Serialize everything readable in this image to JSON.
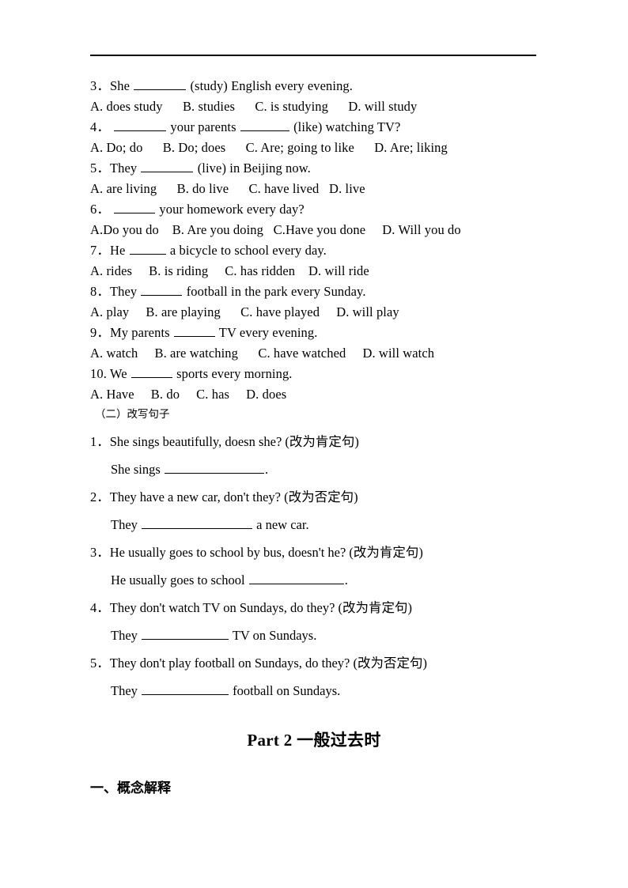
{
  "document": {
    "rule_present": true,
    "mc_questions": [
      {
        "prompt_pre": "3．She ",
        "blank1_width": 66,
        "prompt_post": " (study) English every evening.",
        "options": "A. does study      B. studies      C. is studying      D. will study"
      },
      {
        "prompt_pre": "4． ",
        "blank1_width": 66,
        "prompt_mid": " your parents ",
        "blank2_width": 62,
        "prompt_post": " (like) watching TV?",
        "options": "A. Do; do      B. Do; does      C. Are; going to like      D. Are; liking"
      },
      {
        "prompt_pre": "5．They ",
        "blank1_width": 66,
        "prompt_post": " (live) in Beijing now.",
        "options": "A. are living      B. do live      C. have lived   D. live"
      },
      {
        "prompt_pre": "6． ",
        "blank1_width": 52,
        "prompt_post": " your homework every day?",
        "options": "A.Do you do    B. Are you doing   C.Have you done     D. Will you do"
      },
      {
        "prompt_pre": "7．He ",
        "blank1_width": 46,
        "prompt_post": " a bicycle to school every day.",
        "options": "A. rides     B. is riding     C. has ridden    D. will ride"
      },
      {
        "prompt_pre": "8．They ",
        "blank1_width": 52,
        "prompt_post": " football in the park every Sunday.",
        "options": "A. play     B. are playing      C. have played     D. will play"
      },
      {
        "prompt_pre": "9．My parents ",
        "blank1_width": 52,
        "prompt_post": " TV every evening.",
        "options": "A. watch     B. are watching      C. have watched     D. will watch"
      },
      {
        "prompt_pre": "10. We ",
        "blank1_width": 52,
        "prompt_post": " sports every morning.",
        "options": "A. Have     B. do     C. has     D. does"
      }
    ],
    "rewrite_section": {
      "heading": "（二）改写句子",
      "items": [
        {
          "question": "1．She sings beautifully, doesn she? (改为肯定句)",
          "answer_pre": "She sings ",
          "blank_width": 126,
          "answer_post": "."
        },
        {
          "question": "2．They have a new car, don't they? (改为否定句)",
          "answer_pre": "They ",
          "blank_width": 140,
          "answer_post": " a new car."
        },
        {
          "question": "3．He usually goes to school by bus, doesn't he? (改为肯定句)",
          "answer_pre": "He usually goes to school ",
          "blank_width": 120,
          "answer_post": "."
        },
        {
          "question": "4．They don't watch TV on Sundays, do they? (改为肯定句)",
          "answer_pre": "They ",
          "blank_width": 110,
          "answer_post": " TV on Sundays."
        },
        {
          "question": "5．They don't play football on Sundays, do they? (改为否定句)",
          "answer_pre": "They ",
          "blank_width": 110,
          "answer_post": " football on Sundays."
        }
      ]
    },
    "part_title": {
      "latin": "Part 2 ",
      "chinese": "一般过去时"
    },
    "section_heading": "一、概念解释"
  }
}
